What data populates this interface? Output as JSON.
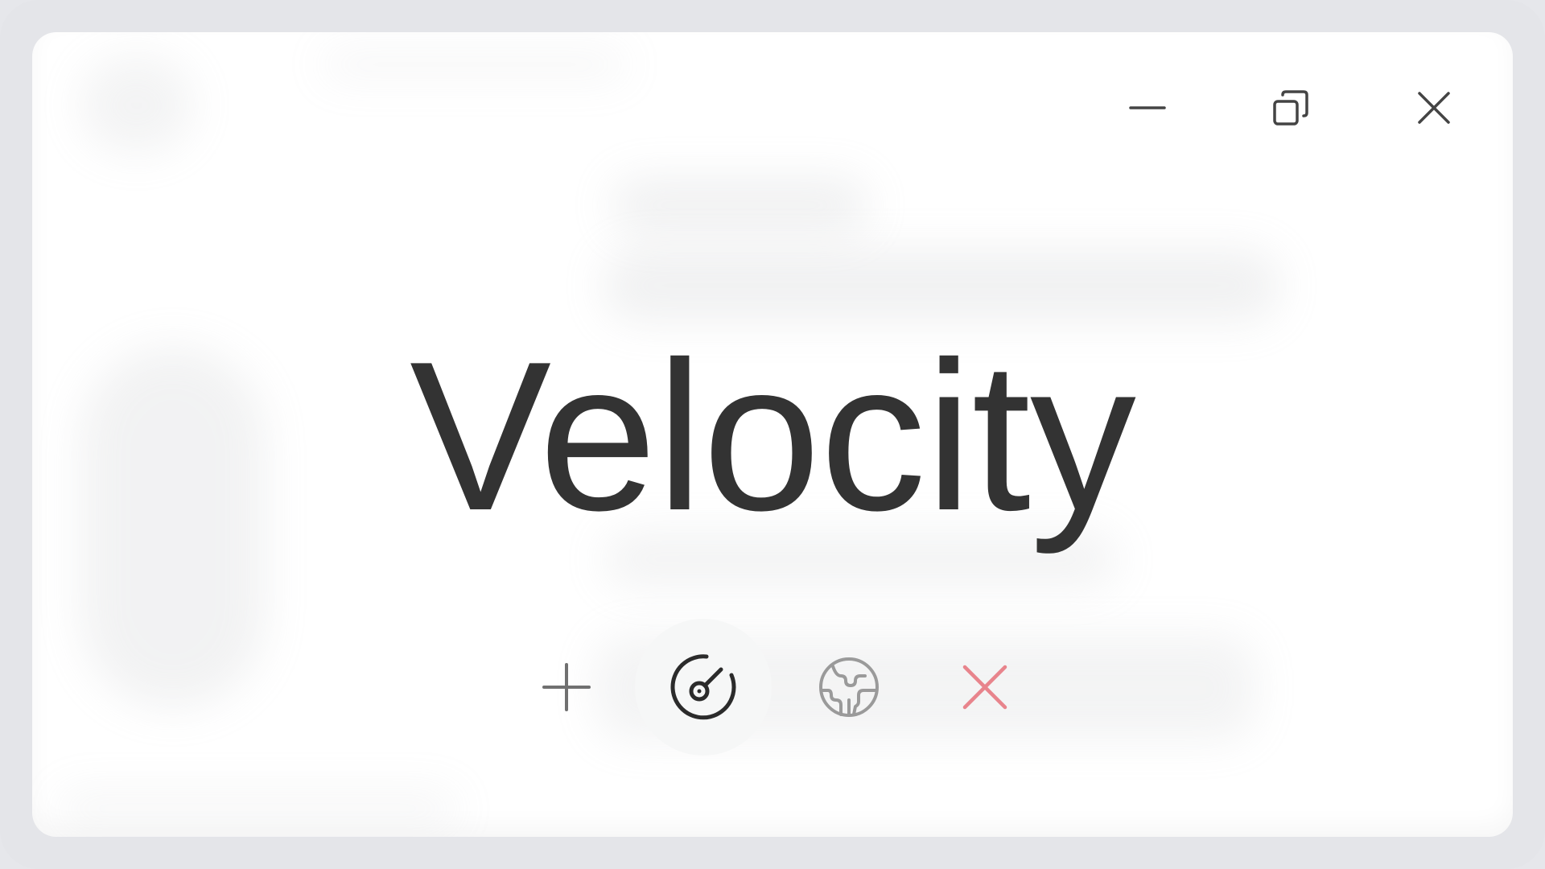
{
  "app": {
    "title": "Velocity"
  },
  "window_controls": {
    "minimize_icon": "minimize-icon",
    "restore_icon": "restore-icon",
    "close_icon": "close-icon"
  },
  "toolbar": {
    "items": [
      {
        "icon": "plus-icon",
        "active": false,
        "color": "#707070"
      },
      {
        "icon": "speedometer-icon",
        "active": true,
        "color": "#2b2b2b"
      },
      {
        "icon": "globe-icon",
        "active": false,
        "color": "#9a9a9a"
      },
      {
        "icon": "close-icon",
        "active": false,
        "color": "#e8848c"
      }
    ]
  },
  "colors": {
    "title": "#333333",
    "frame": "#e4e5e9",
    "window": "#ffffff",
    "active_bg": "#f6f7f7",
    "danger": "#e8848c"
  }
}
